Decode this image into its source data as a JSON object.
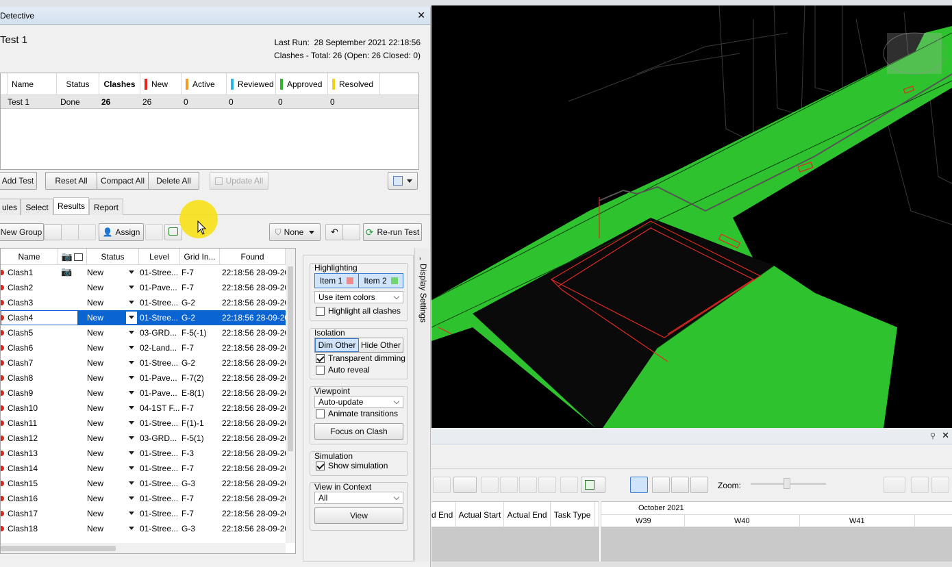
{
  "panel": {
    "title": "Detective",
    "test_name": "Test 1",
    "last_run_label": "Last Run:",
    "last_run_value": "28 September 2021 22:18:56",
    "clashes_summary": "Clashes - Total: 26 (Open: 26 Closed: 0)"
  },
  "tests_table": {
    "columns": [
      "Name",
      "Status",
      "Clashes",
      "New",
      "Active",
      "Reviewed",
      "Approved",
      "Resolved"
    ],
    "status_colors": {
      "New": "#e8261c",
      "Active": "#f59a23",
      "Reviewed": "#2bb5e8",
      "Approved": "#2db82d",
      "Resolved": "#f2d21b"
    },
    "row": {
      "name": "Test 1",
      "status": "Done",
      "clashes": "26",
      "new": "26",
      "active": "0",
      "reviewed": "0",
      "approved": "0",
      "resolved": "0"
    }
  },
  "test_buttons": {
    "add_test": "Add Test",
    "reset_all": "Reset All",
    "compact_all": "Compact All",
    "delete_all": "Delete All",
    "update_all": "Update All"
  },
  "tabs": [
    "ules",
    "Select",
    "Results",
    "Report"
  ],
  "results_toolbar": {
    "new_group": "New Group",
    "assign": "Assign",
    "none": "None",
    "rerun": "Re-run Test"
  },
  "results_table": {
    "columns": {
      "name": "Name",
      "status": "Status",
      "level": "Level",
      "grid": "Grid In...",
      "found": "Found"
    },
    "rows": [
      {
        "name": "Clash1",
        "status": "New",
        "level": "01-Stree...",
        "grid": "F-7",
        "found": "22:18:56 28-09-20"
      },
      {
        "name": "Clash2",
        "status": "New",
        "level": "01-Pave...",
        "grid": "F-7",
        "found": "22:18:56 28-09-20"
      },
      {
        "name": "Clash3",
        "status": "New",
        "level": "01-Stree...",
        "grid": "G-2",
        "found": "22:18:56 28-09-20"
      },
      {
        "name": "Clash4",
        "status": "New",
        "level": "01-Stree...",
        "grid": "G-2",
        "found": "22:18:56 28-09-20"
      },
      {
        "name": "Clash5",
        "status": "New",
        "level": "03-GRD...",
        "grid": "F-5(-1)",
        "found": "22:18:56 28-09-20"
      },
      {
        "name": "Clash6",
        "status": "New",
        "level": "02-Land...",
        "grid": "F-7",
        "found": "22:18:56 28-09-20"
      },
      {
        "name": "Clash7",
        "status": "New",
        "level": "01-Stree...",
        "grid": "G-2",
        "found": "22:18:56 28-09-20"
      },
      {
        "name": "Clash8",
        "status": "New",
        "level": "01-Pave...",
        "grid": "F-7(2)",
        "found": "22:18:56 28-09-20"
      },
      {
        "name": "Clash9",
        "status": "New",
        "level": "01-Pave...",
        "grid": "E-8(1)",
        "found": "22:18:56 28-09-20"
      },
      {
        "name": "Clash10",
        "status": "New",
        "level": "04-1ST F...",
        "grid": "F-7",
        "found": "22:18:56 28-09-20"
      },
      {
        "name": "Clash11",
        "status": "New",
        "level": "01-Stree...",
        "grid": "F(1)-1",
        "found": "22:18:56 28-09-20"
      },
      {
        "name": "Clash12",
        "status": "New",
        "level": "03-GRD...",
        "grid": "F-5(1)",
        "found": "22:18:56 28-09-20"
      },
      {
        "name": "Clash13",
        "status": "New",
        "level": "01-Stree...",
        "grid": "F-3",
        "found": "22:18:56 28-09-20"
      },
      {
        "name": "Clash14",
        "status": "New",
        "level": "01-Stree...",
        "grid": "F-7",
        "found": "22:18:56 28-09-20"
      },
      {
        "name": "Clash15",
        "status": "New",
        "level": "01-Stree...",
        "grid": "G-3",
        "found": "22:18:56 28-09-20"
      },
      {
        "name": "Clash16",
        "status": "New",
        "level": "01-Stree...",
        "grid": "F-7",
        "found": "22:18:56 28-09-20"
      },
      {
        "name": "Clash17",
        "status": "New",
        "level": "01-Stree...",
        "grid": "F-7",
        "found": "22:18:56 28-09-20"
      },
      {
        "name": "Clash18",
        "status": "New",
        "level": "01-Stree...",
        "grid": "G-3",
        "found": "22:18:56 28-09-20"
      }
    ],
    "selected_row": "Clash4"
  },
  "display_settings": {
    "side_label": "Display Settings",
    "highlighting": {
      "title": "Highlighting",
      "item1": "Item 1",
      "item2": "Item 2",
      "item1_color": "#f08b8b",
      "item2_color": "#6fd66f",
      "color_mode": "Use item colors",
      "highlight_all": "Highlight all clashes"
    },
    "isolation": {
      "title": "Isolation",
      "dim_other": "Dim Other",
      "hide_other": "Hide Other",
      "transparent_dimming": "Transparent dimming",
      "auto_reveal": "Auto reveal"
    },
    "viewpoint": {
      "title": "Viewpoint",
      "mode": "Auto-update",
      "animate": "Animate transitions",
      "focus": "Focus on Clash"
    },
    "simulation": {
      "title": "Simulation",
      "show": "Show simulation"
    },
    "context": {
      "title": "View in Context",
      "value": "All",
      "view": "View"
    }
  },
  "timeliner": {
    "zoom_label": "Zoom:",
    "columns": [
      "d End",
      "Actual Start",
      "Actual End",
      "Task Type"
    ],
    "month": "October 2021",
    "weeks": [
      "W39",
      "W40",
      "W41"
    ]
  },
  "colors": {
    "selection": "#0a64d2",
    "clash_green": "#2ec22e",
    "clash_red": "#e02a20",
    "highlight_cursor": "#f7e018"
  }
}
